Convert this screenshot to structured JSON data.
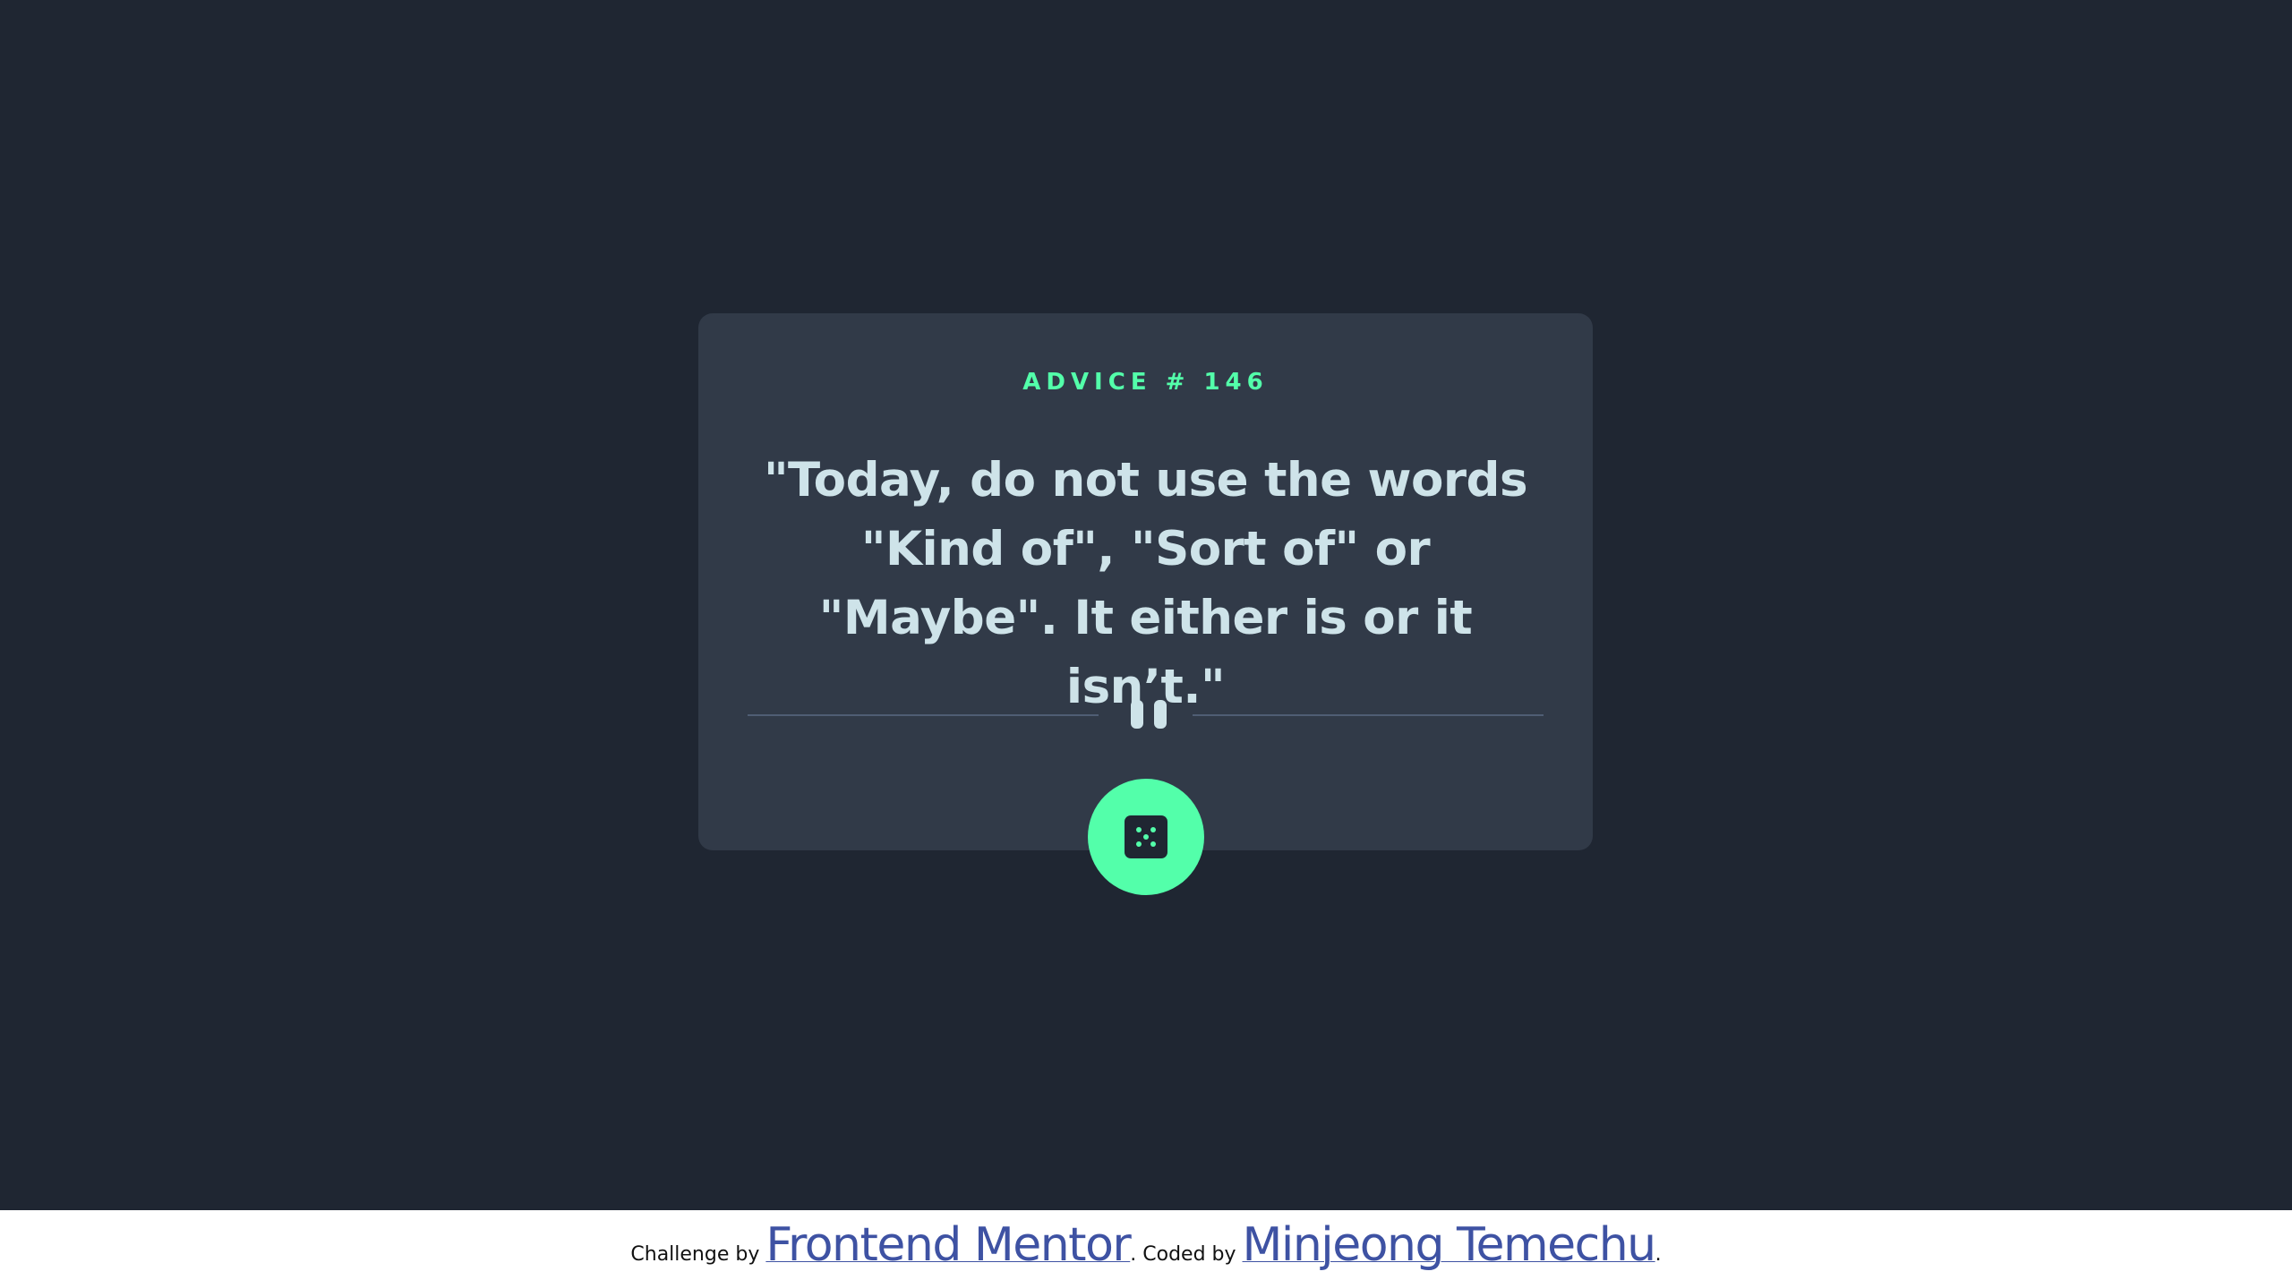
{
  "card": {
    "advice_label": "ADVICE # 146",
    "advice_text": "\"Today, do not use the words \"Kind of\", \"Sort of\" or \"Maybe\". It either is or it isn’t.\""
  },
  "icons": {
    "divider": "pause-icon",
    "button": "dice-icon"
  },
  "footer": {
    "prefix": "Challenge by ",
    "challenge_link": "Frontend Mentor",
    "middle": ". Coded by ",
    "author_link": "Minjeong Temechu",
    "suffix": "."
  },
  "colors": {
    "background": "#1f2632",
    "card": "#313a48",
    "accent": "#53ffaa",
    "text": "#cee3e9",
    "link": "#3e52a3"
  }
}
